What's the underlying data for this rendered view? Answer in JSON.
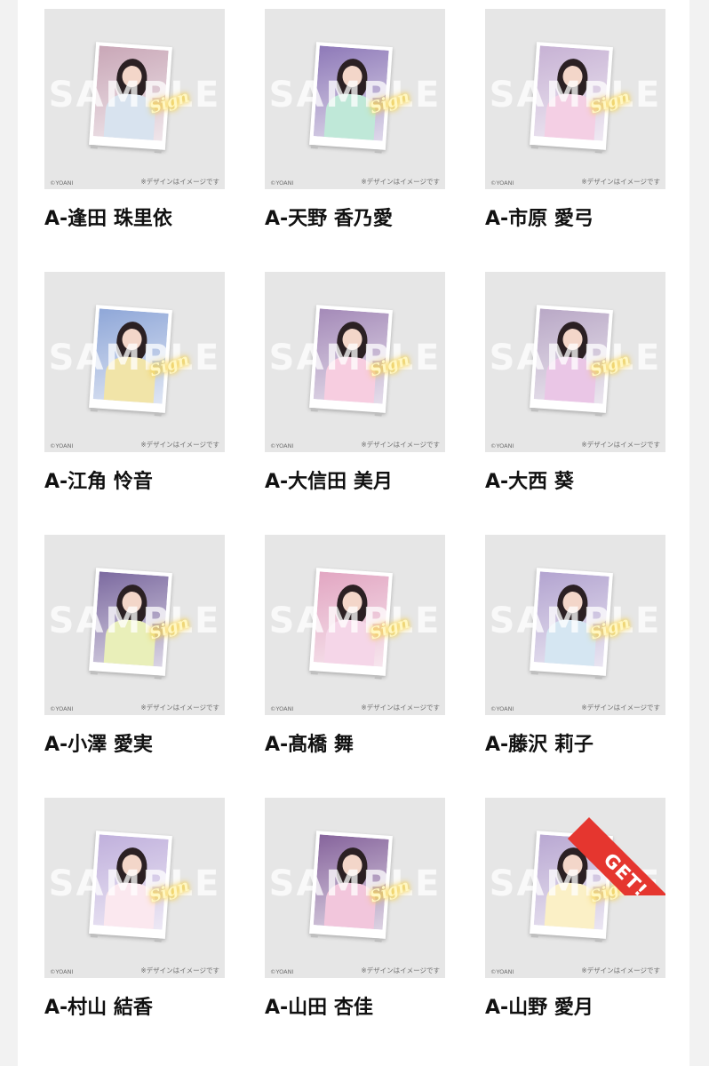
{
  "watermark": "SAMPLE",
  "sign_text": "Sign",
  "credit": "©YOANI",
  "note": "※デザインはイメージです",
  "get_badge": "GET!",
  "colors": {
    "accent_red": "#e5362f",
    "thumb_bg": "#e6e6e6",
    "sign_glow": "#f5d650"
  },
  "items": [
    {
      "name": "A-逢田 珠里依",
      "bg": "#c9a7b7",
      "outfit": "#d8e3ef",
      "obtained": false
    },
    {
      "name": "A-天野 香乃愛",
      "bg": "#8e79b8",
      "outfit": "#bfe8d8",
      "obtained": false
    },
    {
      "name": "A-市原 愛弓",
      "bg": "#c7b2d4",
      "outfit": "#f4cfe4",
      "obtained": false
    },
    {
      "name": "A-江角 怜音",
      "bg": "#8fa7d8",
      "outfit": "#f1e4a8",
      "obtained": false
    },
    {
      "name": "A-大信田 美月",
      "bg": "#a48ab8",
      "outfit": "#f7cde0",
      "obtained": false
    },
    {
      "name": "A-大西 葵",
      "bg": "#b9a8c6",
      "outfit": "#eac6e6",
      "obtained": false
    },
    {
      "name": "A-小澤 愛実",
      "bg": "#7c6aa0",
      "outfit": "#e9efb9",
      "obtained": false
    },
    {
      "name": "A-髙橋 舞",
      "bg": "#e2a6c2",
      "outfit": "#f5d6e8",
      "obtained": false
    },
    {
      "name": "A-藤沢 莉子",
      "bg": "#b3a4d0",
      "outfit": "#d5e6f2",
      "obtained": false
    },
    {
      "name": "A-村山 結香",
      "bg": "#c0b0dc",
      "outfit": "#fbe8ef",
      "obtained": false
    },
    {
      "name": "A-山田 杏佳",
      "bg": "#86649c",
      "outfit": "#f2c6dc",
      "obtained": false
    },
    {
      "name": "A-山野 愛月",
      "bg": "#b9a8d2",
      "outfit": "#fbf0c6",
      "obtained": true
    }
  ]
}
